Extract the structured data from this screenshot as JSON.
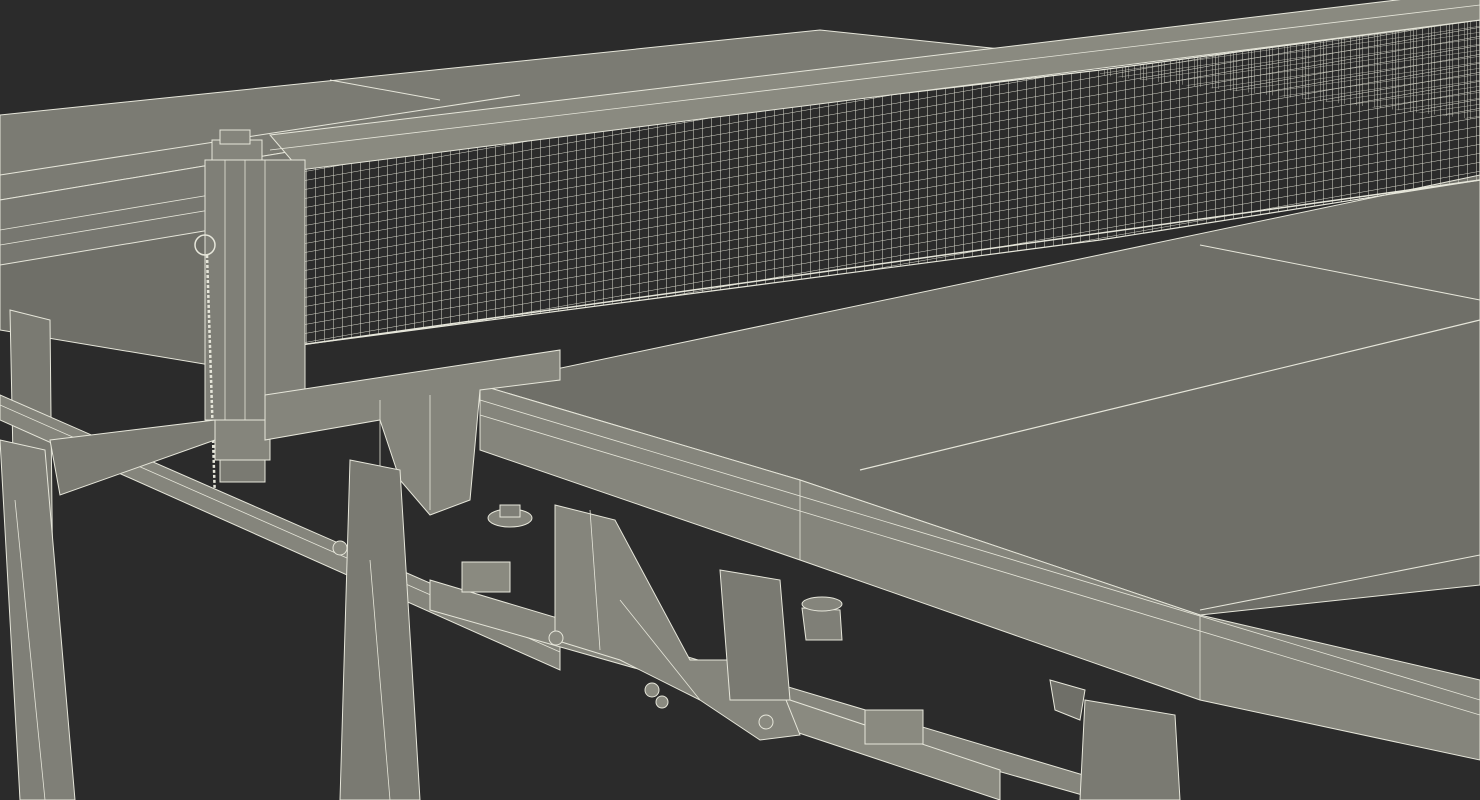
{
  "viewport": {
    "background": "#2b2b2b",
    "subject": "table-tennis-table-wireframe-render"
  },
  "colors": {
    "surface": "#6f6f68",
    "surface_light": "#7a7a72",
    "frame": "#85857c",
    "frame_dark": "#5f5f59",
    "wire": "#e6e6da",
    "net_mesh": "#d9d9cc"
  },
  "icons": {
    "net_post": "net-post-icon",
    "ball_chain": "ball-chain-icon",
    "leveling_foot": "leveling-foot-icon",
    "hinge_bolt": "hinge-bolt-icon"
  }
}
